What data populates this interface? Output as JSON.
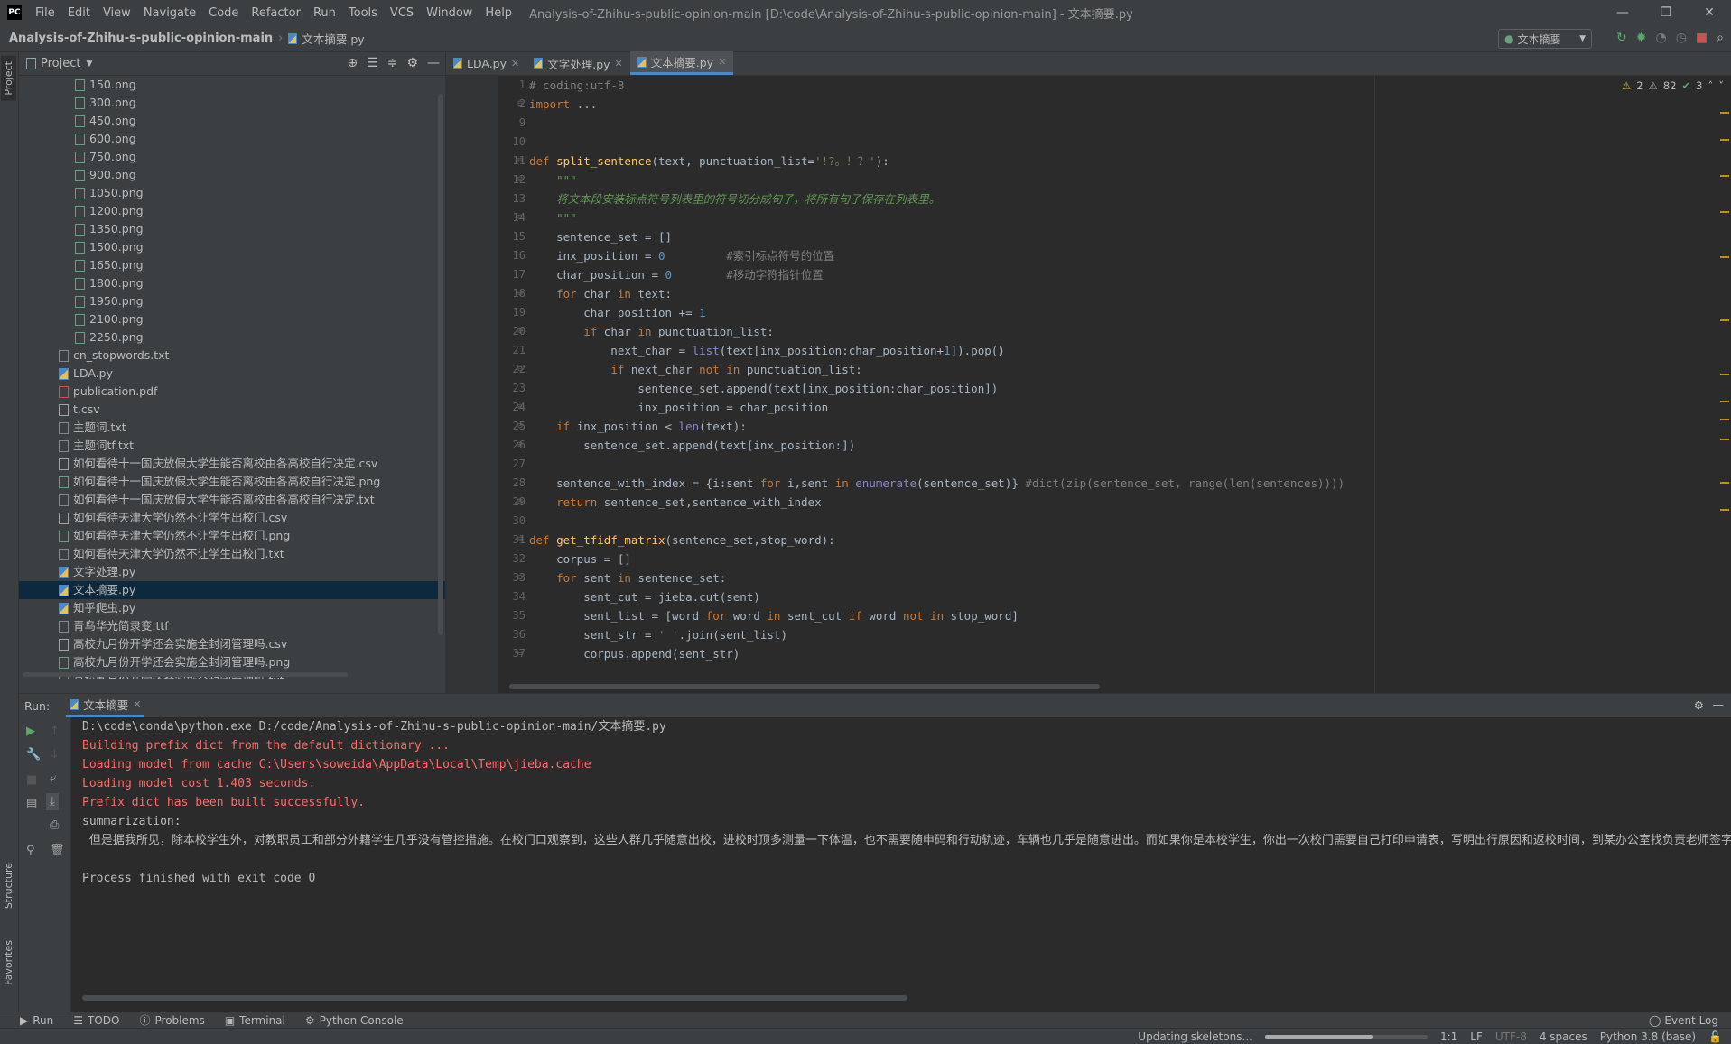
{
  "menu": [
    "File",
    "Edit",
    "View",
    "Navigate",
    "Code",
    "Refactor",
    "Run",
    "Tools",
    "VCS",
    "Window",
    "Help"
  ],
  "window_title": "Analysis-of-Zhihu-s-public-opinion-main [D:\\code\\Analysis-of-Zhihu-s-public-opinion-main] - 文本摘要.py",
  "breadcrumb": {
    "project": "Analysis-of-Zhihu-s-public-opinion-main",
    "file": "文本摘要.py"
  },
  "run_config": "文本摘要",
  "sidebar_left": {
    "project": "Project",
    "structure": "Structure",
    "favorites": "Favorites"
  },
  "project_panel": {
    "title": "Project",
    "files": [
      {
        "name": "150.png",
        "indent": 62,
        "type": "png"
      },
      {
        "name": "300.png",
        "indent": 62,
        "type": "png"
      },
      {
        "name": "450.png",
        "indent": 62,
        "type": "png"
      },
      {
        "name": "600.png",
        "indent": 62,
        "type": "png"
      },
      {
        "name": "750.png",
        "indent": 62,
        "type": "png"
      },
      {
        "name": "900.png",
        "indent": 62,
        "type": "png"
      },
      {
        "name": "1050.png",
        "indent": 62,
        "type": "png"
      },
      {
        "name": "1200.png",
        "indent": 62,
        "type": "png"
      },
      {
        "name": "1350.png",
        "indent": 62,
        "type": "png"
      },
      {
        "name": "1500.png",
        "indent": 62,
        "type": "png"
      },
      {
        "name": "1650.png",
        "indent": 62,
        "type": "png"
      },
      {
        "name": "1800.png",
        "indent": 62,
        "type": "png"
      },
      {
        "name": "1950.png",
        "indent": 62,
        "type": "png"
      },
      {
        "name": "2100.png",
        "indent": 62,
        "type": "png"
      },
      {
        "name": "2250.png",
        "indent": 62,
        "type": "png"
      },
      {
        "name": "cn_stopwords.txt",
        "indent": 44,
        "type": "txt"
      },
      {
        "name": "LDA.py",
        "indent": 44,
        "type": "py"
      },
      {
        "name": "publication.pdf",
        "indent": 44,
        "type": "pdf"
      },
      {
        "name": "t.csv",
        "indent": 44,
        "type": "csv"
      },
      {
        "name": "主题词.txt",
        "indent": 44,
        "type": "txt"
      },
      {
        "name": "主题词tf.txt",
        "indent": 44,
        "type": "txt"
      },
      {
        "name": "如何看待十一国庆放假大学生能否离校由各高校自行决定.csv",
        "indent": 44,
        "type": "csv"
      },
      {
        "name": "如何看待十一国庆放假大学生能否离校由各高校自行决定.png",
        "indent": 44,
        "type": "png"
      },
      {
        "name": "如何看待十一国庆放假大学生能否离校由各高校自行决定.txt",
        "indent": 44,
        "type": "txt"
      },
      {
        "name": "如何看待天津大学仍然不让学生出校门.csv",
        "indent": 44,
        "type": "csv"
      },
      {
        "name": "如何看待天津大学仍然不让学生出校门.png",
        "indent": 44,
        "type": "png"
      },
      {
        "name": "如何看待天津大学仍然不让学生出校门.txt",
        "indent": 44,
        "type": "txt"
      },
      {
        "name": "文字处理.py",
        "indent": 44,
        "type": "py"
      },
      {
        "name": "文本摘要.py",
        "indent": 44,
        "type": "py",
        "selected": true
      },
      {
        "name": "知乎爬虫.py",
        "indent": 44,
        "type": "py"
      },
      {
        "name": "青鸟华光简隶变.ttf",
        "indent": 44,
        "type": "txt"
      },
      {
        "name": "高校九月份开学还会实施全封闭管理吗.csv",
        "indent": 44,
        "type": "csv"
      },
      {
        "name": "高校九月份开学还会实施全封闭管理吗.png",
        "indent": 44,
        "type": "png"
      },
      {
        "name": "高校九月份开学还会实施全封闭管理吗.txt",
        "indent": 44,
        "type": "txt"
      }
    ]
  },
  "editor_tabs": [
    {
      "label": "LDA.py",
      "active": false
    },
    {
      "label": "文字处理.py",
      "active": false
    },
    {
      "label": "文本摘要.py",
      "active": true
    }
  ],
  "inspections": {
    "warnings": "2",
    "weak_warnings": "82",
    "ok": "3"
  },
  "code_lines": [
    {
      "n": "1",
      "html": "<span class='cm'># coding:utf-8</span>"
    },
    {
      "n": "2",
      "html": "<span class='kw'>import</span> ..."
    },
    {
      "n": "9",
      "html": ""
    },
    {
      "n": "10",
      "html": ""
    },
    {
      "n": "11",
      "html": "<span class='kw'>def</span> <span class='fn'>split_sentence</span>(text, punctuation_list=<span class='str'>'!?。！？'</span>):"
    },
    {
      "n": "12",
      "html": "    <span class='doc'>\"\"\"</span>"
    },
    {
      "n": "13",
      "html": "    <span class='doc'>将文本段安装标点符号列表里的符号切分成句子，将所有句子保存在列表里。</span>"
    },
    {
      "n": "14",
      "html": "    <span class='doc'>\"\"\"</span>"
    },
    {
      "n": "15",
      "html": "    sentence_set = []"
    },
    {
      "n": "16",
      "html": "    inx_position = <span class='num'>0</span>         <span class='cm'>#索引标点符号的位置</span>"
    },
    {
      "n": "17",
      "html": "    char_position = <span class='num'>0</span>        <span class='cm'>#移动字符指针位置</span>"
    },
    {
      "n": "18",
      "html": "    <span class='kw'>for</span> char <span class='kw'>in</span> text:"
    },
    {
      "n": "19",
      "html": "        char_position += <span class='num'>1</span>"
    },
    {
      "n": "20",
      "html": "        <span class='kw'>if</span> char <span class='kw'>in</span> punctuation_list:"
    },
    {
      "n": "21",
      "html": "            next_char = <span class='bi'>list</span>(text[inx_position:char_position+<span class='num'>1</span>]).pop()"
    },
    {
      "n": "22",
      "html": "            <span class='kw'>if</span> next_char <span class='kw'>not in</span> punctuation_list:"
    },
    {
      "n": "23",
      "html": "                sentence_set.append(text[inx_position:char_position])"
    },
    {
      "n": "24",
      "html": "                inx_position = char_position"
    },
    {
      "n": "25",
      "html": "    <span class='kw'>if</span> inx_position &lt; <span class='bi'>len</span>(text):"
    },
    {
      "n": "26",
      "html": "        sentence_set.append(text[inx_position:])"
    },
    {
      "n": "27",
      "html": ""
    },
    {
      "n": "28",
      "html": "    sentence_with_index = {i:sent <span class='kw'>for</span> i,sent <span class='kw'>in</span> <span class='bi'>enumerate</span>(sentence_set)} <span class='cm'>#dict(zip(sentence_set, range(len(sentences))))</span>"
    },
    {
      "n": "29",
      "html": "    <span class='kw'>return</span> sentence_set,sentence_with_index"
    },
    {
      "n": "30",
      "html": ""
    },
    {
      "n": "31",
      "html": "<span class='kw'>def</span> <span class='fn'>get_tfidf_matrix</span>(sentence_set,stop_word):"
    },
    {
      "n": "32",
      "html": "    corpus = []"
    },
    {
      "n": "33",
      "html": "    <span class='kw'>for</span> sent <span class='kw'>in</span> sentence_set:"
    },
    {
      "n": "34",
      "html": "        sent_cut = jieba.cut(sent)"
    },
    {
      "n": "35",
      "html": "        sent_list = [word <span class='kw'>for</span> word <span class='kw'>in</span> sent_cut <span class='kw'>if</span> word <span class='kw'>not in</span> stop_word]"
    },
    {
      "n": "36",
      "html": "        sent_str = <span class='str'>' '</span>.join(sent_list)"
    },
    {
      "n": "37",
      "html": "        corpus.append(sent_str)"
    }
  ],
  "run_panel": {
    "label": "Run:",
    "tab": "文本摘要",
    "console": [
      {
        "text": "D:\\code\\conda\\python.exe D:/code/Analysis-of-Zhihu-s-public-opinion-main/文本摘要.py",
        "cls": "out"
      },
      {
        "text": "Building prefix dict from the default dictionary ...",
        "cls": "err"
      },
      {
        "text": "Loading model from cache C:\\Users\\soweida\\AppData\\Local\\Temp\\jieba.cache",
        "cls": "err"
      },
      {
        "text": "Loading model cost 1.403 seconds.",
        "cls": "err"
      },
      {
        "text": "Prefix dict has been built successfully.",
        "cls": "err"
      },
      {
        "text": "summarization:",
        "cls": "out"
      },
      {
        "text": " 但是据我所见，除本校学生外，对教职员工和部分外籍学生几乎没有管控措施。在校门口观察到，这些人群几乎随意出校，进校时顶多测量一下体温，也不需要随申码和行动轨迹，车辆也几乎是随意进出。而如果你是本校学生，你出一次校门需要自己打印申请表，写明出行原因和返校时间，到某办公室找负责老师签字",
        "cls": "out"
      },
      {
        "text": "",
        "cls": "out"
      },
      {
        "text": "Process finished with exit code 0",
        "cls": "out"
      }
    ]
  },
  "bottom_tabs": [
    "Run",
    "TODO",
    "Problems",
    "Terminal",
    "Python Console"
  ],
  "event_log": "Event Log",
  "status": {
    "task": "Updating skeletons...",
    "progress": 0.66,
    "position": "1:1",
    "line_sep": "LF",
    "encoding": "UTF-8",
    "indent": "4 spaces",
    "interpreter": "Python 3.8 (base)"
  }
}
